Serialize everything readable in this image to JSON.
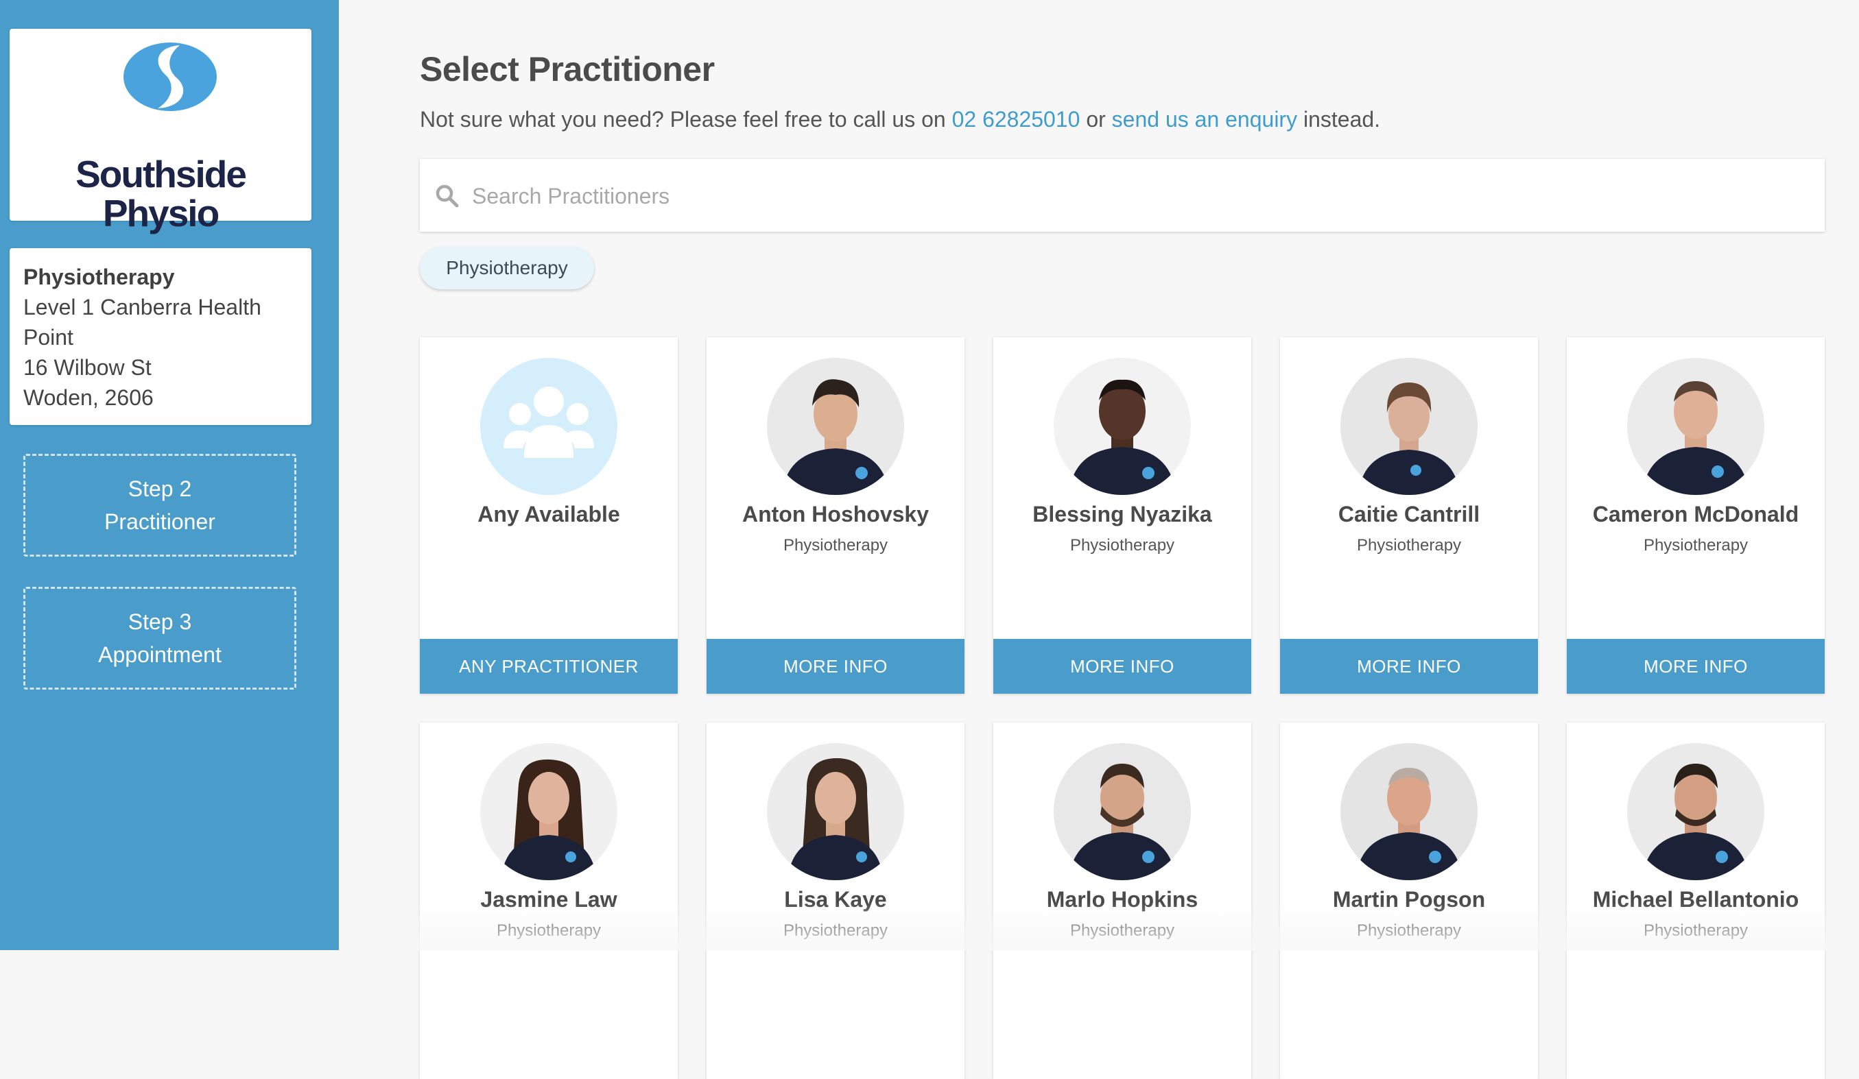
{
  "brand": {
    "line1": "Southside",
    "line2": "Physio",
    "colors": {
      "accent": "#4a9ccb",
      "navy": "#1c2447",
      "logo_blue": "#4aa3dc"
    }
  },
  "location": {
    "service": "Physiotherapy",
    "address": "Level 1 Canberra Health\nPoint\n16 Wilbow St\nWoden, 2606"
  },
  "steps": [
    {
      "line1": "Step 2",
      "line2": "Practitioner"
    },
    {
      "line1": "Step 3",
      "line2": "Appointment"
    }
  ],
  "main": {
    "title": "Select Practitioner",
    "intro_prefix": "Not sure what you need? Please feel free to call us on ",
    "phone": "02 62825010",
    "intro_mid": " or ",
    "enquiry": "send us an enquiry",
    "intro_suffix": " instead.",
    "search_placeholder": "Search Practitioners",
    "filter": "Physiotherapy"
  },
  "practitioners": [
    {
      "name": "Any Available",
      "service": "",
      "button": "ANY PRACTITIONER",
      "icon": "group-icon"
    },
    {
      "name": "Anton Hoshovsky",
      "service": "Physiotherapy",
      "button": "MORE INFO"
    },
    {
      "name": "Blessing Nyazika",
      "service": "Physiotherapy",
      "button": "MORE INFO"
    },
    {
      "name": "Caitie Cantrill",
      "service": "Physiotherapy",
      "button": "MORE INFO"
    },
    {
      "name": "Cameron McDonald",
      "service": "Physiotherapy",
      "button": "MORE INFO"
    },
    {
      "name": "Jasmine Law",
      "service": "Physiotherapy"
    },
    {
      "name": "Lisa Kaye",
      "service": "Physiotherapy"
    },
    {
      "name": "Marlo Hopkins",
      "service": "Physiotherapy"
    },
    {
      "name": "Martin Pogson",
      "service": "Physiotherapy"
    },
    {
      "name": "Michael Bellantonio",
      "service": "Physiotherapy"
    }
  ]
}
